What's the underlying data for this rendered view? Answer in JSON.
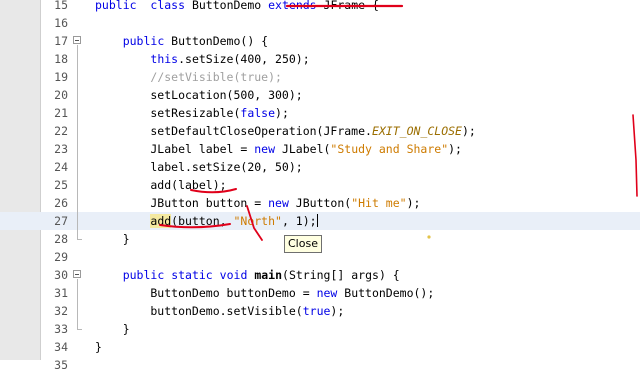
{
  "editor": {
    "lines": [
      {
        "num": "15",
        "tokens": [
          [
            "kw",
            "public"
          ],
          [
            "",
            "  "
          ],
          [
            "kw",
            "class"
          ],
          [
            "",
            " ButtonDemo "
          ],
          [
            "kw",
            "extends"
          ],
          [
            "",
            " JFrame {"
          ]
        ]
      },
      {
        "num": "16",
        "tokens": []
      },
      {
        "num": "17",
        "fold": true,
        "tokens": [
          [
            "",
            "    "
          ],
          [
            "kw",
            "public"
          ],
          [
            "",
            " ButtonDemo() {"
          ]
        ]
      },
      {
        "num": "18",
        "tokens": [
          [
            "",
            "        "
          ],
          [
            "kw",
            "this"
          ],
          [
            "",
            ".setSize(400, 250);"
          ]
        ]
      },
      {
        "num": "19",
        "tokens": [
          [
            "",
            "        "
          ],
          [
            "cm",
            "//setVisible(true);"
          ]
        ]
      },
      {
        "num": "20",
        "tokens": [
          [
            "",
            "        setLocation(500, 300);"
          ]
        ]
      },
      {
        "num": "21",
        "tokens": [
          [
            "",
            "        setResizable("
          ],
          [
            "kw",
            "false"
          ],
          [
            "",
            ");"
          ]
        ]
      },
      {
        "num": "22",
        "tokens": [
          [
            "",
            "        setDefaultCloseOperation(JFrame."
          ],
          [
            "cn",
            "EXIT_ON_CLOSE"
          ],
          [
            "",
            ");"
          ]
        ]
      },
      {
        "num": "23",
        "tokens": [
          [
            "",
            "        JLabel label = "
          ],
          [
            "kw",
            "new"
          ],
          [
            "",
            " JLabel("
          ],
          [
            "st",
            "\"Study and Share\""
          ],
          [
            "",
            ");"
          ]
        ]
      },
      {
        "num": "24",
        "tokens": [
          [
            "",
            "        label.setSize(20, 50);"
          ]
        ]
      },
      {
        "num": "25",
        "tokens": [
          [
            "",
            "        add(label);"
          ]
        ]
      },
      {
        "num": "26",
        "tokens": [
          [
            "",
            "        JButton button = "
          ],
          [
            "kw",
            "new"
          ],
          [
            "",
            " JButton("
          ],
          [
            "st",
            "\"Hit me\""
          ],
          [
            "",
            ");"
          ]
        ]
      },
      {
        "num": "27",
        "current": true,
        "tokens": [
          [
            "",
            "        "
          ],
          [
            "hl",
            "add"
          ],
          [
            "",
            "(button, "
          ],
          [
            "st",
            "\"North\""
          ],
          [
            "",
            ", 1);"
          ]
        ]
      },
      {
        "num": "28",
        "tokens": [
          [
            "",
            "    }"
          ]
        ]
      },
      {
        "num": "29",
        "tokens": []
      },
      {
        "num": "30",
        "fold": true,
        "tokens": [
          [
            "",
            "    "
          ],
          [
            "kw",
            "public"
          ],
          [
            "",
            " "
          ],
          [
            "kw",
            "static"
          ],
          [
            "",
            " "
          ],
          [
            "kw",
            "void"
          ],
          [
            "",
            " "
          ],
          [
            "bd",
            "main"
          ],
          [
            "",
            "(String[] args) {"
          ]
        ]
      },
      {
        "num": "31",
        "tokens": [
          [
            "",
            "        ButtonDemo buttonDemo = "
          ],
          [
            "kw",
            "new"
          ],
          [
            "",
            " ButtonDemo();"
          ]
        ]
      },
      {
        "num": "32",
        "tokens": [
          [
            "",
            "        buttonDemo.setVisible("
          ],
          [
            "kw",
            "true"
          ],
          [
            "",
            ");"
          ]
        ]
      },
      {
        "num": "33",
        "tokens": [
          [
            "",
            "    }"
          ]
        ]
      },
      {
        "num": "34",
        "tokens": [
          [
            "",
            "}"
          ]
        ]
      },
      {
        "num": "35",
        "tokens": []
      }
    ],
    "tooltip": "Close"
  },
  "colors": {
    "keyword": "#0000e6",
    "string": "#ce7b00",
    "comment": "#a0a0a0",
    "annotation": "#e0001a",
    "current_line": "#e9eff8"
  }
}
